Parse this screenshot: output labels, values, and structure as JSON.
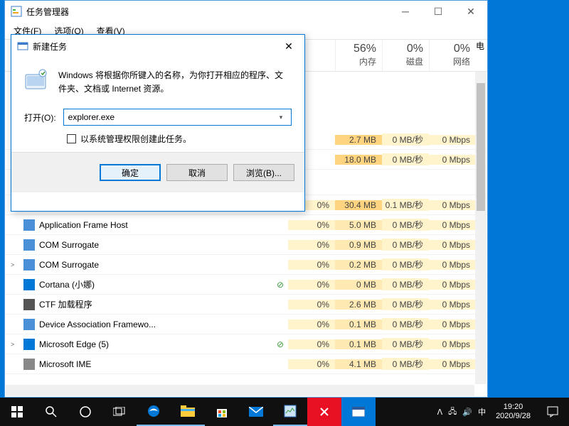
{
  "tm": {
    "title": "任务管理器",
    "menus": [
      "文件(F)",
      "选项(O)",
      "查看(V)"
    ],
    "headers": {
      "cpu": {
        "pct": "",
        "label": ""
      },
      "mem": {
        "pct": "56%",
        "label": "内存"
      },
      "disk": {
        "pct": "0%",
        "label": "磁盘"
      },
      "net": {
        "pct": "0%",
        "label": "网络"
      }
    },
    "rows": [
      {
        "name": "",
        "cpu": "",
        "mem": "2.7 MB",
        "disk": "0 MB/秒",
        "net": "0 Mbps",
        "mem_hi": true,
        "blank": true
      },
      {
        "name": "",
        "cpu": "",
        "mem": "18.0 MB",
        "disk": "0 MB/秒",
        "net": "0 Mbps",
        "mem_hi": true,
        "blank": true
      },
      {
        "name": "",
        "cpu": "",
        "mem": "",
        "disk": "",
        "net": "",
        "spacer": true
      },
      {
        "expand": ">",
        "name": "",
        "cpu": "0%",
        "mem": "30.4 MB",
        "disk": "0.1 MB/秒",
        "net": "0 Mbps",
        "mem_hi": true
      },
      {
        "name": "Application Frame Host",
        "cpu": "0%",
        "mem": "5.0 MB",
        "disk": "0 MB/秒",
        "net": "0 Mbps"
      },
      {
        "name": "COM Surrogate",
        "cpu": "0%",
        "mem": "0.9 MB",
        "disk": "0 MB/秒",
        "net": "0 Mbps"
      },
      {
        "expand": ">",
        "name": "COM Surrogate",
        "cpu": "0%",
        "mem": "0.2 MB",
        "disk": "0 MB/秒",
        "net": "0 Mbps"
      },
      {
        "name": "Cortana (小娜)",
        "cpu": "0%",
        "mem": "0 MB",
        "disk": "0 MB/秒",
        "net": "0 Mbps",
        "leaf": true,
        "icon": "#0078d7"
      },
      {
        "name": "CTF 加载程序",
        "cpu": "0%",
        "mem": "2.6 MB",
        "disk": "0 MB/秒",
        "net": "0 Mbps",
        "icon": "#555"
      },
      {
        "name": "Device Association Framewo...",
        "cpu": "0%",
        "mem": "0.1 MB",
        "disk": "0 MB/秒",
        "net": "0 Mbps"
      },
      {
        "expand": ">",
        "name": "Microsoft Edge (5)",
        "cpu": "0%",
        "mem": "0.1 MB",
        "disk": "0 MB/秒",
        "net": "0 Mbps",
        "leaf": true,
        "icon": "#0078d7"
      },
      {
        "name": "Microsoft IME",
        "cpu": "0%",
        "mem": "4.1 MB",
        "disk": "0 MB/秒",
        "net": "0 Mbps",
        "icon": "#888"
      }
    ]
  },
  "dlg": {
    "title": "新建任务",
    "desc": "Windows 将根据你所键入的名称，为你打开相应的程序、文件夹、文档或 Internet 资源。",
    "open_label": "打开(O):",
    "value": "explorer.exe",
    "admin_check": "以系统管理权限创建此任务。",
    "btn_ok": "确定",
    "btn_cancel": "取消",
    "btn_browse": "浏览(B)..."
  },
  "taskbar": {
    "ime": "中",
    "time": "19:20",
    "date": "2020/9/28"
  }
}
